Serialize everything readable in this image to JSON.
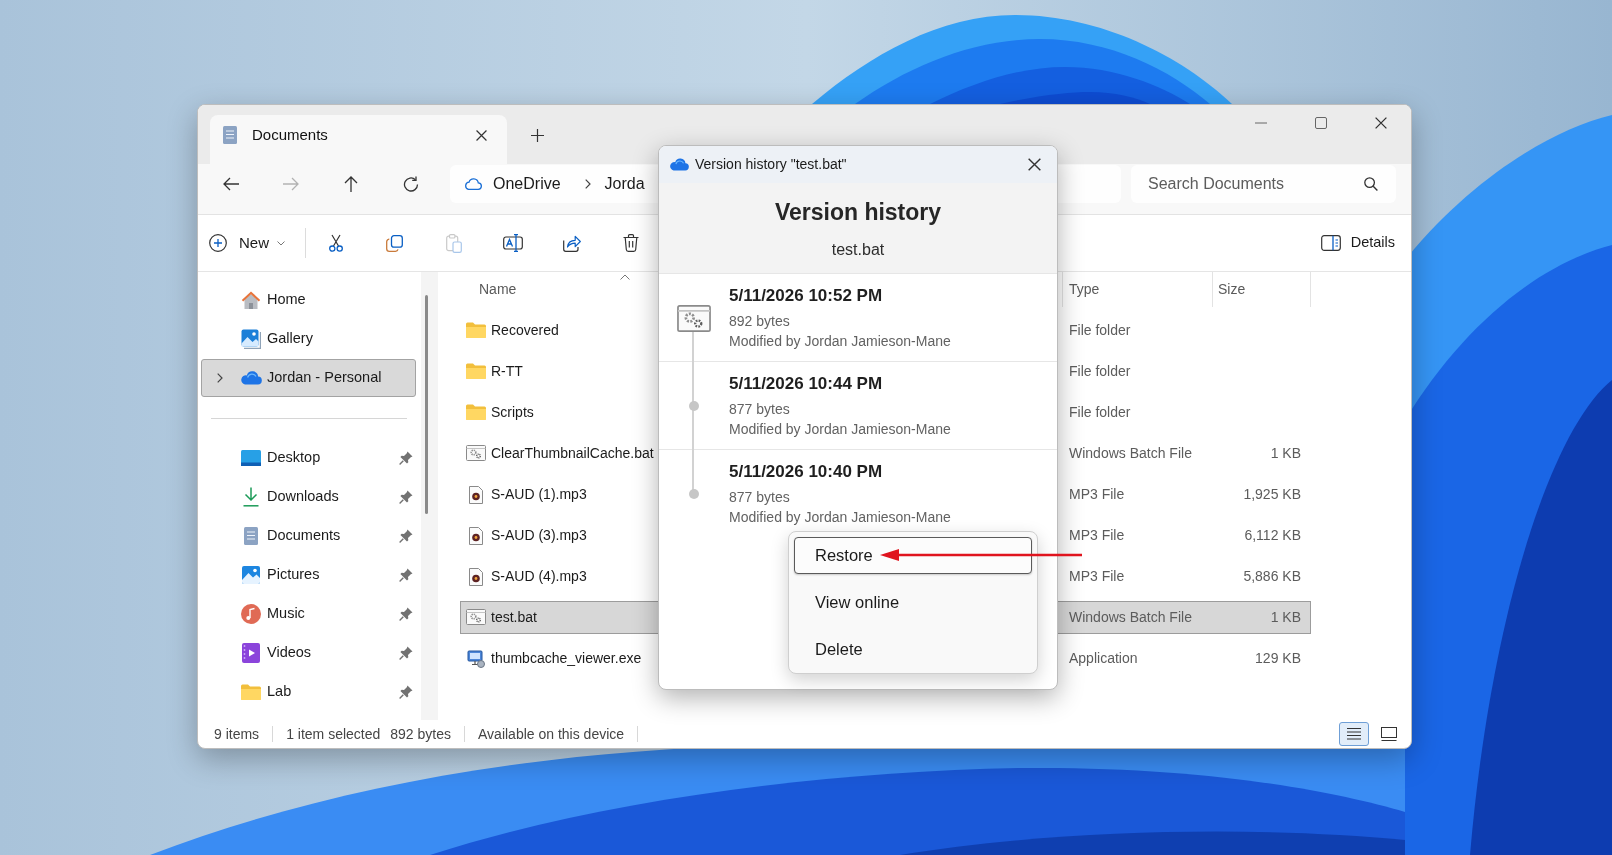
{
  "explorer": {
    "tabs": [
      {
        "label": "Documents",
        "selected": true
      }
    ],
    "nav_buttons": [
      {
        "kind": "back",
        "disabled": false
      },
      {
        "kind": "forward",
        "disabled": true
      },
      {
        "kind": "up",
        "disabled": false
      },
      {
        "kind": "refresh",
        "disabled": false
      }
    ],
    "address": {
      "crumbs": [
        "OneDrive",
        "Jorda"
      ]
    },
    "search": {
      "placeholder": "Search Documents"
    },
    "commands": [
      {
        "kind": "new",
        "label": "New",
        "disabled": false
      },
      {
        "kind": "cut",
        "disabled": false
      },
      {
        "kind": "copy",
        "disabled": false
      },
      {
        "kind": "paste",
        "disabled": true
      },
      {
        "kind": "rename",
        "disabled": false
      },
      {
        "kind": "share",
        "disabled": false
      },
      {
        "kind": "delete",
        "disabled": false
      }
    ],
    "details_button": {
      "label": "Details"
    },
    "sidebar": {
      "groups": [
        {
          "items": [
            {
              "label": "Home",
              "kind": "home",
              "selected": false,
              "expandable": false,
              "pinned": false
            },
            {
              "label": "Gallery",
              "kind": "gallery",
              "selected": false,
              "expandable": false,
              "pinned": false
            },
            {
              "label": "Jordan - Personal",
              "kind": "cloud",
              "selected": true,
              "expandable": true,
              "pinned": false
            }
          ]
        },
        {
          "items": [
            {
              "label": "Desktop",
              "kind": "desktop",
              "selected": false,
              "expandable": false,
              "pinned": true
            },
            {
              "label": "Downloads",
              "kind": "downloads",
              "selected": false,
              "expandable": false,
              "pinned": true
            },
            {
              "label": "Documents",
              "kind": "documents",
              "selected": false,
              "expandable": false,
              "pinned": true
            },
            {
              "label": "Pictures",
              "kind": "pictures",
              "selected": false,
              "expandable": false,
              "pinned": true
            },
            {
              "label": "Music",
              "kind": "music",
              "selected": false,
              "expandable": false,
              "pinned": true
            },
            {
              "label": "Videos",
              "kind": "videos",
              "selected": false,
              "expandable": false,
              "pinned": true
            },
            {
              "label": "Lab",
              "kind": "folder",
              "selected": false,
              "expandable": false,
              "pinned": true
            }
          ]
        }
      ]
    },
    "columns": [
      {
        "label": "Name",
        "sorted": true
      },
      {
        "label": "Type",
        "sorted": false
      },
      {
        "label": "Size",
        "sorted": false
      }
    ],
    "rows": [
      {
        "name": "Recovered",
        "kind": "folder",
        "type": "File folder",
        "selected": false
      },
      {
        "name": "R-TT",
        "kind": "folder",
        "type": "File folder",
        "selected": false
      },
      {
        "name": "Scripts",
        "kind": "folder",
        "type": "File folder",
        "selected": false
      },
      {
        "name": "ClearThumbnailCache.bat",
        "kind": "batch",
        "type": "Windows Batch File",
        "size": "1 KB",
        "selected": false
      },
      {
        "name": "S-AUD (1).mp3",
        "kind": "audio",
        "type": "MP3 File",
        "size": "1,925 KB",
        "selected": false
      },
      {
        "name": "S-AUD (3).mp3",
        "kind": "audio",
        "type": "MP3 File",
        "size": "6,112 KB",
        "selected": false
      },
      {
        "name": "S-AUD (4).mp3",
        "kind": "audio",
        "type": "MP3 File",
        "size": "5,886 KB",
        "selected": false
      },
      {
        "name": "test.bat",
        "kind": "batch",
        "type": "Windows Batch File",
        "size": "1 KB",
        "selected": true
      },
      {
        "name": "thumbcache_viewer.exe",
        "kind": "app",
        "type": "Application",
        "size": "129 KB",
        "selected": false
      }
    ],
    "status_bar": {
      "sections": [
        {
          "texts": [
            "9 items"
          ]
        },
        {
          "texts": [
            "1 item selected",
            "892 bytes"
          ]
        },
        {
          "texts": [
            "Available on this device"
          ]
        }
      ]
    },
    "views": [
      {
        "kind": "details",
        "selected": true
      },
      {
        "kind": "tiles",
        "selected": false
      }
    ]
  },
  "dialog": {
    "title": "Version history \"test.bat\"",
    "heading": "Version history",
    "file_name": "test.bat",
    "versions": [
      {
        "date": "5/11/2026 10:52 PM",
        "size": "892 bytes",
        "modified_by": "Modified by Jordan Jamieson-Mane",
        "current": true
      },
      {
        "date": "5/11/2026 10:44 PM",
        "size": "877 bytes",
        "modified_by": "Modified by Jordan Jamieson-Mane",
        "current": false
      },
      {
        "date": "5/11/2026 10:40 PM",
        "size": "877 bytes",
        "modified_by": "Modified by Jordan Jamieson-Mane",
        "current": false
      }
    ]
  },
  "context_menu": {
    "items": [
      {
        "label": "Restore",
        "selected": true
      },
      {
        "label": "View online",
        "selected": false
      },
      {
        "label": "Delete",
        "selected": false
      }
    ]
  }
}
